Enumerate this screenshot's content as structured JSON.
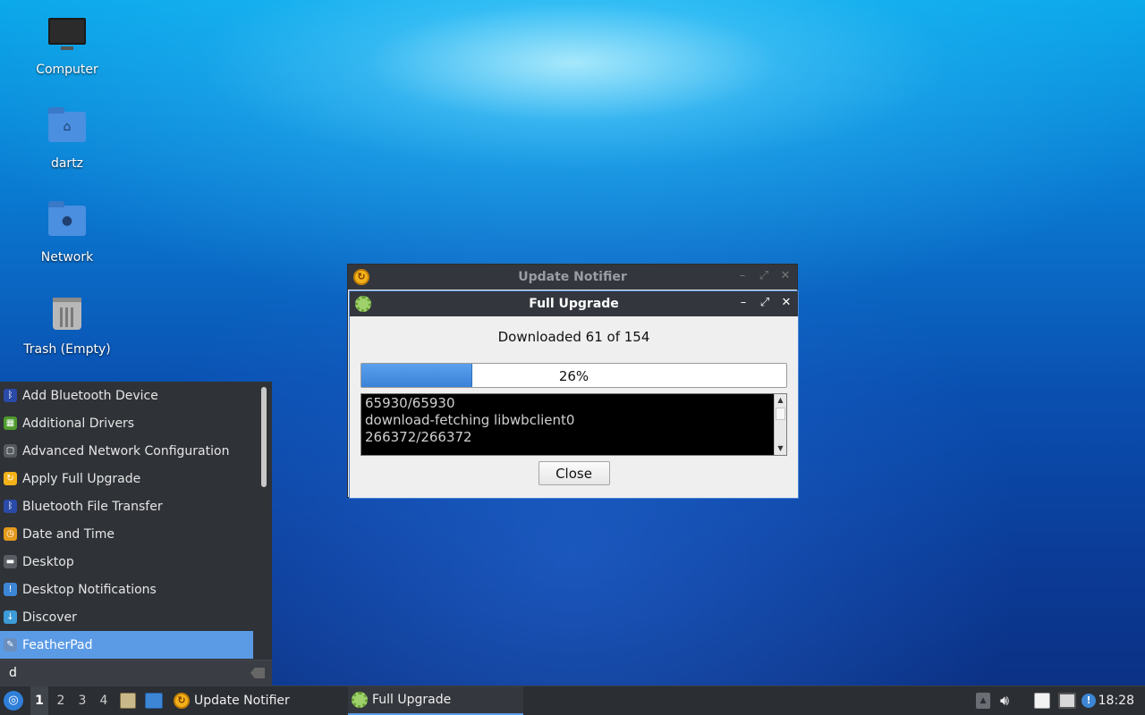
{
  "desktop": {
    "icons": [
      {
        "label": "Computer"
      },
      {
        "label": "dartz"
      },
      {
        "label": "Network"
      },
      {
        "label": "Trash (Empty)"
      }
    ]
  },
  "update_notifier_window": {
    "title": "Update Notifier"
  },
  "upgrade_window": {
    "title": "Full Upgrade",
    "status": "Downloaded 61 of 154",
    "progress": {
      "fraction": 0.26,
      "label": "26%"
    },
    "log_lines": [
      "65930/65930",
      "download-fetching libwbclient0",
      "266372/266372"
    ],
    "close_label": "Close",
    "controls": {
      "minimize": "–",
      "maximize": "⤢",
      "close": "✕"
    }
  },
  "app_menu": {
    "items": [
      {
        "label": "Add Bluetooth Device",
        "icon": "bluetooth-icon",
        "color": "#2a4aa8",
        "glyph": "ᛒ"
      },
      {
        "label": "Additional Drivers",
        "icon": "chip-icon",
        "color": "#4e9a2e",
        "glyph": "▦"
      },
      {
        "label": "Advanced Network Configuration",
        "icon": "network-icon",
        "color": "#555a60",
        "glyph": "▢"
      },
      {
        "label": "Apply Full Upgrade",
        "icon": "upgrade-icon",
        "color": "#f3b21a",
        "glyph": "↻"
      },
      {
        "label": "Bluetooth File Transfer",
        "icon": "bluetooth-icon",
        "color": "#2a4aa8",
        "glyph": "ᛒ"
      },
      {
        "label": "Date and Time",
        "icon": "clock-icon",
        "color": "#e39a1c",
        "glyph": "◷"
      },
      {
        "label": "Desktop",
        "icon": "desktop-icon",
        "color": "#5a5e64",
        "glyph": "▬"
      },
      {
        "label": "Desktop Notifications",
        "icon": "notification-icon",
        "color": "#3d86d6",
        "glyph": "!"
      },
      {
        "label": "Discover",
        "icon": "discover-icon",
        "color": "#3d9bd8",
        "glyph": "↓"
      },
      {
        "label": "FeatherPad",
        "icon": "featherpad-icon",
        "color": "#6a8fbf",
        "glyph": "✎"
      }
    ],
    "active_index": 9,
    "search_value": "d"
  },
  "taskbar": {
    "workspaces": [
      "1",
      "2",
      "3",
      "4"
    ],
    "active_workspace": 0,
    "tasks": [
      {
        "label": "Update Notifier"
      },
      {
        "label": "Full Upgrade"
      }
    ],
    "clock": "18:28"
  }
}
